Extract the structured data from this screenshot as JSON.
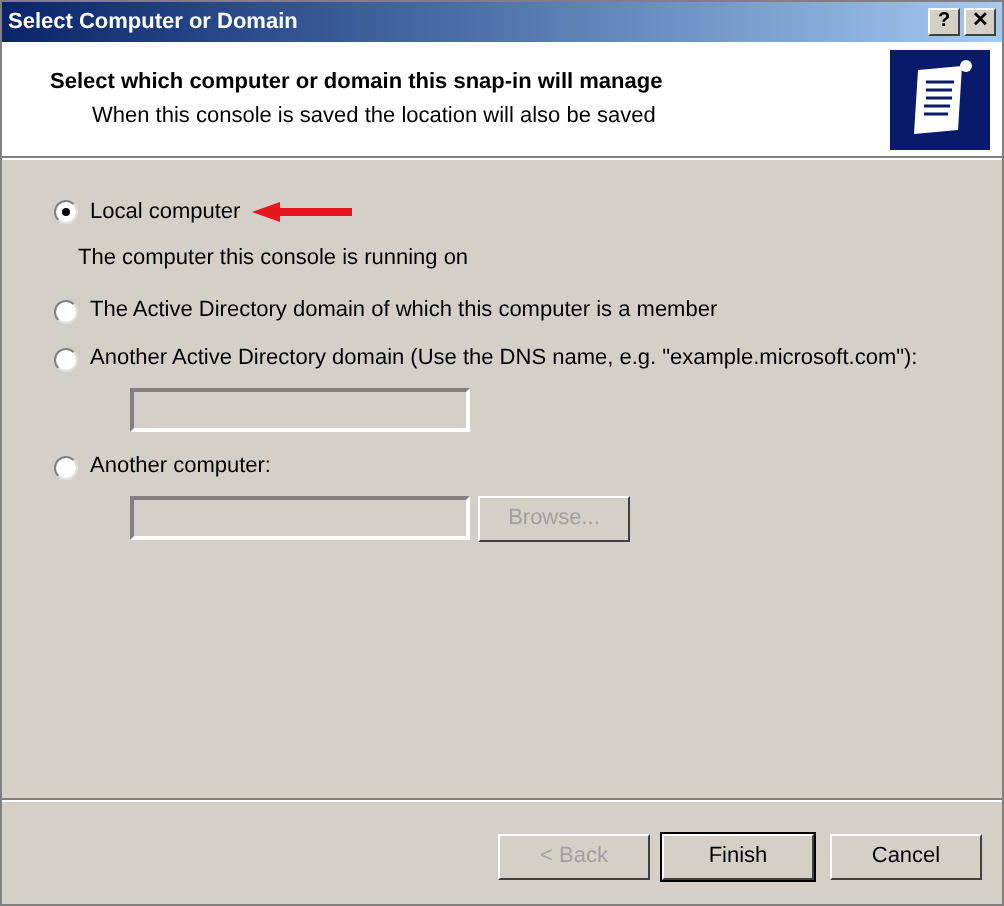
{
  "window": {
    "title": "Select Computer or Domain",
    "controls": [
      "?",
      "✕"
    ]
  },
  "header": {
    "title": "Select which computer or domain this snap-in will manage",
    "subtitle": "When this console is saved the location will also be saved"
  },
  "options": [
    {
      "label": "Local computer",
      "selected": true,
      "description": "The computer this console is running on"
    },
    {
      "label": "The Active Directory domain of which this computer is a member",
      "selected": false
    },
    {
      "label": "Another Active Directory domain (Use the DNS name, e.g. \"example.microsoft.com\"):",
      "selected": false,
      "field": {
        "disabled": true
      }
    },
    {
      "label": "Another computer:",
      "selected": false,
      "field": {
        "disabled": true
      },
      "browse": {
        "label": "Browse...",
        "disabled": true
      }
    }
  ],
  "buttons": [
    {
      "label": "< Back",
      "disabled": true,
      "default": false
    },
    {
      "label": "Finish",
      "disabled": false,
      "default": true
    },
    {
      "label": "Cancel",
      "disabled": false,
      "default": false
    }
  ]
}
